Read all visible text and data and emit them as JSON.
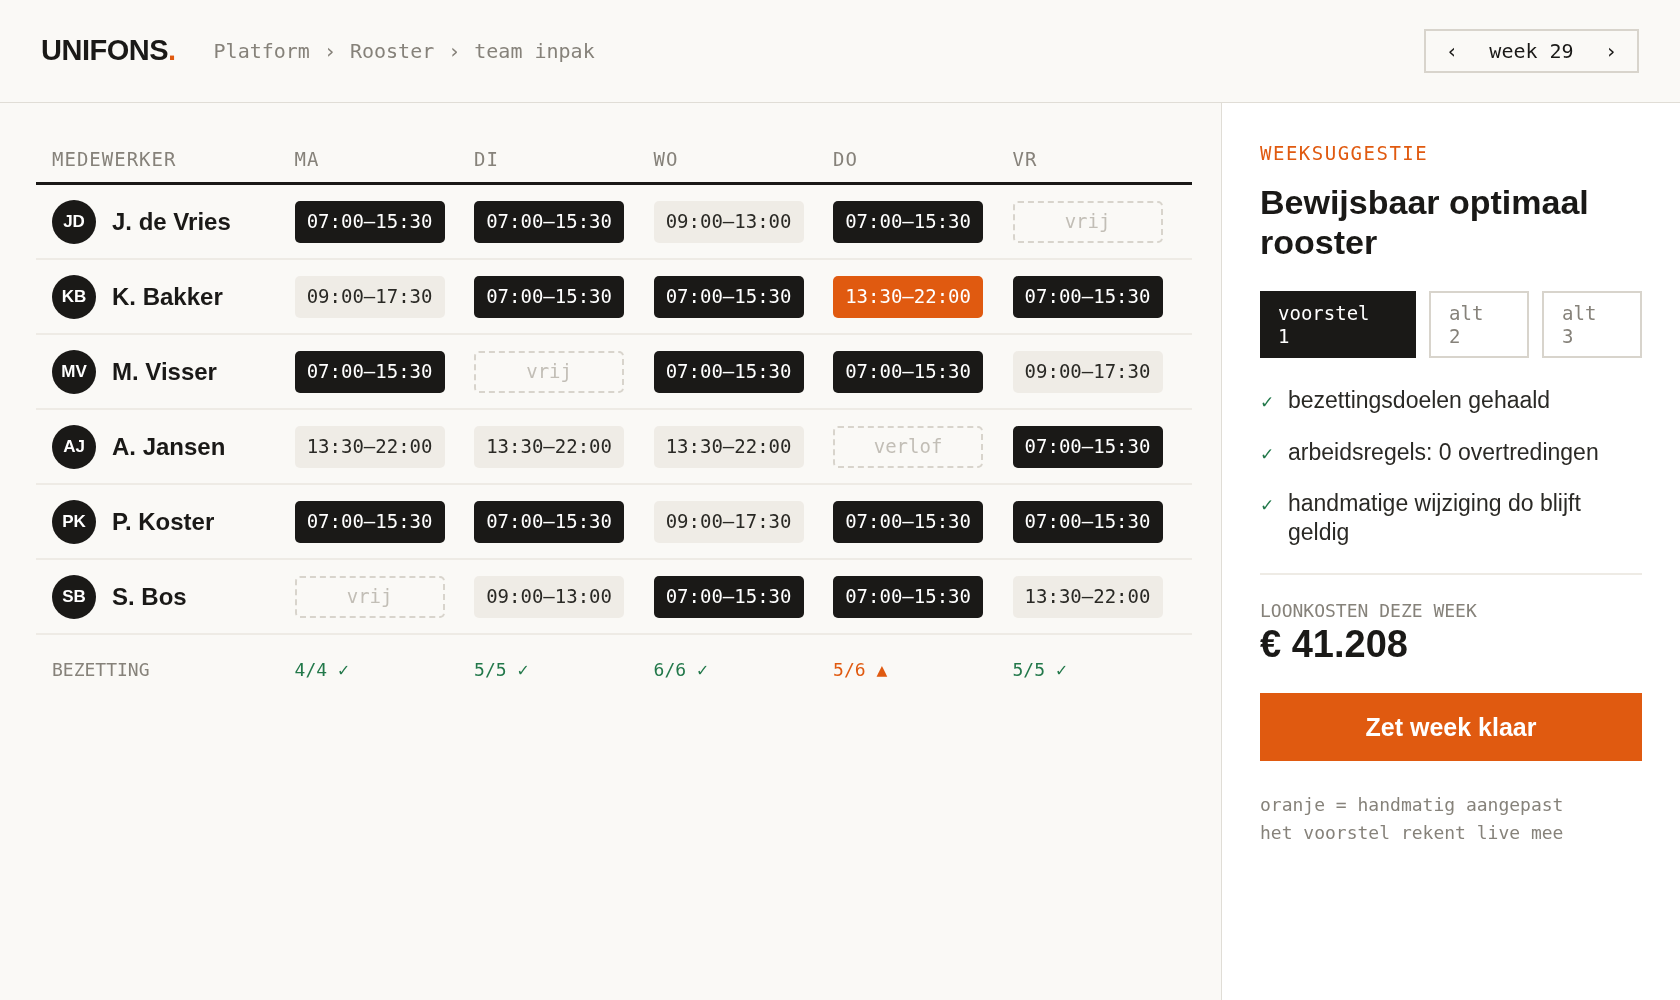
{
  "header": {
    "logo": "UNIFONS",
    "logo_dot": ".",
    "breadcrumb": [
      "Platform",
      "Rooster",
      "team inpak"
    ],
    "breadcrumb_separator": "›",
    "week": {
      "prev": "‹",
      "label": "week 29",
      "next": "›"
    }
  },
  "table": {
    "columns": [
      "MEDEWERKER",
      "MA",
      "DI",
      "WO",
      "DO",
      "VR"
    ],
    "rows": [
      {
        "initials": "JD",
        "name": "J. de Vries",
        "shifts": [
          {
            "kind": "fixed",
            "text": "07:00–15:30"
          },
          {
            "kind": "fixed",
            "text": "07:00–15:30"
          },
          {
            "kind": "flex",
            "text": "09:00–13:00"
          },
          {
            "kind": "fixed",
            "text": "07:00–15:30"
          },
          {
            "kind": "off",
            "text": "vrij"
          }
        ]
      },
      {
        "initials": "KB",
        "name": "K. Bakker",
        "shifts": [
          {
            "kind": "flex",
            "text": "09:00–17:30"
          },
          {
            "kind": "fixed",
            "text": "07:00–15:30"
          },
          {
            "kind": "fixed",
            "text": "07:00–15:30"
          },
          {
            "kind": "manual",
            "text": "13:30–22:00"
          },
          {
            "kind": "fixed",
            "text": "07:00–15:30"
          }
        ]
      },
      {
        "initials": "MV",
        "name": "M. Visser",
        "shifts": [
          {
            "kind": "fixed",
            "text": "07:00–15:30"
          },
          {
            "kind": "off",
            "text": "vrij"
          },
          {
            "kind": "fixed",
            "text": "07:00–15:30"
          },
          {
            "kind": "fixed",
            "text": "07:00–15:30"
          },
          {
            "kind": "flex",
            "text": "09:00–17:30"
          }
        ]
      },
      {
        "initials": "AJ",
        "name": "A. Jansen",
        "shifts": [
          {
            "kind": "flex",
            "text": "13:30–22:00"
          },
          {
            "kind": "flex",
            "text": "13:30–22:00"
          },
          {
            "kind": "flex",
            "text": "13:30–22:00"
          },
          {
            "kind": "off",
            "text": "verlof"
          },
          {
            "kind": "fixed",
            "text": "07:00–15:30"
          }
        ]
      },
      {
        "initials": "PK",
        "name": "P. Koster",
        "shifts": [
          {
            "kind": "fixed",
            "text": "07:00–15:30"
          },
          {
            "kind": "fixed",
            "text": "07:00–15:30"
          },
          {
            "kind": "flex",
            "text": "09:00–17:30"
          },
          {
            "kind": "fixed",
            "text": "07:00–15:30"
          },
          {
            "kind": "fixed",
            "text": "07:00–15:30"
          }
        ]
      },
      {
        "initials": "SB",
        "name": "S. Bos",
        "shifts": [
          {
            "kind": "off",
            "text": "vrij"
          },
          {
            "kind": "flex",
            "text": "09:00–13:00"
          },
          {
            "kind": "fixed",
            "text": "07:00–15:30"
          },
          {
            "kind": "fixed",
            "text": "07:00–15:30"
          },
          {
            "kind": "flex",
            "text": "13:30–22:00"
          }
        ]
      }
    ],
    "footer": {
      "label": "BEZETTING",
      "cells": [
        {
          "warning": false,
          "text": "4/4 ✓"
        },
        {
          "warning": false,
          "text": "5/5 ✓"
        },
        {
          "warning": false,
          "text": "6/6 ✓"
        },
        {
          "warning": true,
          "text": "5/6 ▲"
        },
        {
          "warning": false,
          "text": "5/5 ✓"
        }
      ]
    }
  },
  "panel": {
    "eyebrow": "WEEKSUGGESTIE",
    "title": "Bewijsbaar optimaal rooster",
    "options": [
      {
        "line1": "voorstel",
        "line2": "1",
        "selected": true
      },
      {
        "line1": "alt",
        "line2": "2",
        "selected": false
      },
      {
        "line1": "alt",
        "line2": "3",
        "selected": false
      }
    ],
    "checks": [
      {
        "mark": "✓",
        "text": "bezettingsdoelen gehaald"
      },
      {
        "mark": "✓",
        "text": "arbeidsregels: 0 overtredingen"
      },
      {
        "mark": "✓",
        "text": "handmatige wijziging do blijft geldig"
      }
    ],
    "cost_label": "LOONKOSTEN DEZE WEEK",
    "cost": "€ 41.208",
    "button": "Zet week klaar",
    "notes": [
      "oranje = handmatig aangepast",
      "het voorstel rekent live mee"
    ]
  }
}
